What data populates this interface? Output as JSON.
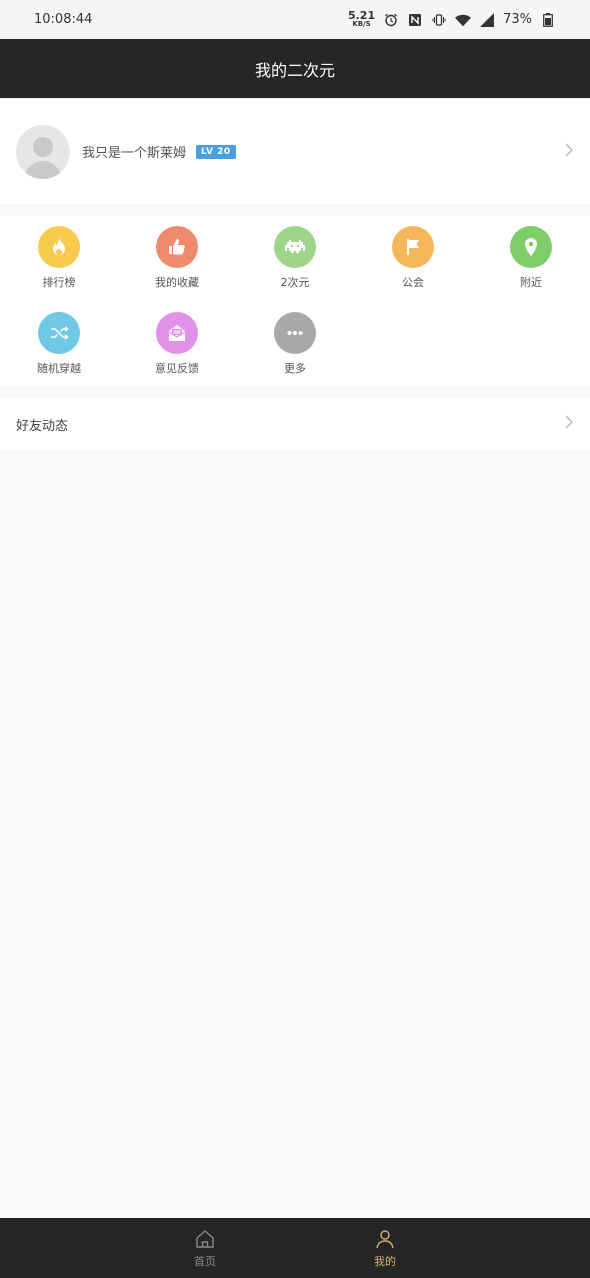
{
  "status_bar": {
    "time": "10:08:44",
    "net_speed_value": "5.21",
    "net_speed_unit": "KB/S",
    "battery": "73%"
  },
  "header": {
    "title": "我的二次元"
  },
  "profile": {
    "username": "我只是一个斯莱姆",
    "level": "LV 20"
  },
  "grid": {
    "items": [
      {
        "label": "排行榜",
        "icon": "fire-icon",
        "color": "#f7cb4d"
      },
      {
        "label": "我的收藏",
        "icon": "thumbs-up-icon",
        "color": "#f08a6f"
      },
      {
        "label": "2次元",
        "icon": "space-invader-icon",
        "color": "#9fd58a"
      },
      {
        "label": "公会",
        "icon": "flag-icon",
        "color": "#f6b75b"
      },
      {
        "label": "附近",
        "icon": "location-pin-icon",
        "color": "#7fcc6a"
      },
      {
        "label": "随机穿越",
        "icon": "shuffle-icon",
        "color": "#6fc8e6"
      },
      {
        "label": "意见反馈",
        "icon": "mail-open-icon",
        "color": "#e091e8"
      },
      {
        "label": "更多",
        "icon": "more-dots-icon",
        "color": "#a9a9a9"
      }
    ]
  },
  "friends": {
    "label": "好友动态"
  },
  "bottom_nav": {
    "home_label": "首页",
    "mine_label": "我的",
    "active_color": "#d8b070",
    "inactive_color": "#8a8a8a"
  }
}
